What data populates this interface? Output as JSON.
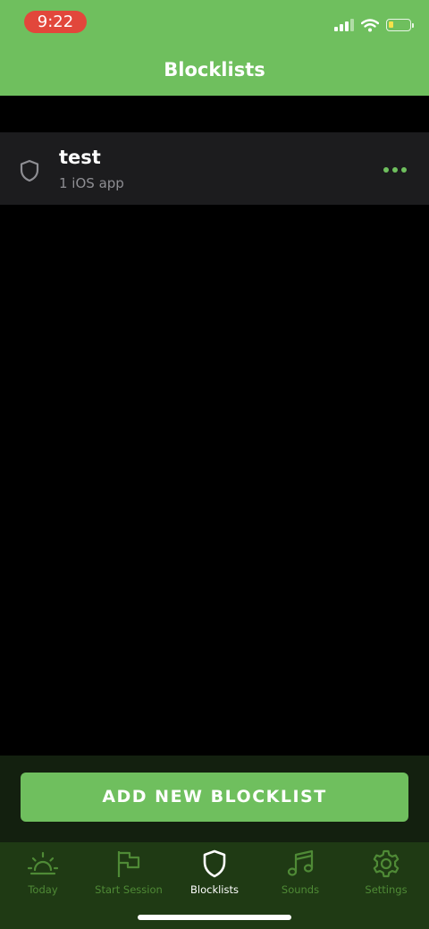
{
  "status_bar": {
    "time": "9:22",
    "icons": [
      "cellular-signal-icon",
      "wifi-icon",
      "battery-icon"
    ],
    "battery_level": 0.25
  },
  "header": {
    "title": "Blocklists"
  },
  "blocklists": [
    {
      "name": "test",
      "detail": "1 iOS app",
      "icon": "shield-icon",
      "menu_icon": "more-options-icon"
    }
  ],
  "actions": {
    "add_label": "ADD NEW BLOCKLIST"
  },
  "tabs": [
    {
      "label": "Today",
      "icon": "sunrise-icon",
      "active": false
    },
    {
      "label": "Start Session",
      "icon": "flag-icon",
      "active": false
    },
    {
      "label": "Blocklists",
      "icon": "shield-icon",
      "active": true
    },
    {
      "label": "Sounds",
      "icon": "music-note-icon",
      "active": false
    },
    {
      "label": "Settings",
      "icon": "gear-icon",
      "active": false
    }
  ],
  "colors": {
    "accent": "#6fbf5e",
    "time_pill": "#e2473b",
    "tab_inactive": "#4f8a36",
    "tab_bar": "#1f3a14",
    "list_row": "#1c1c1e"
  }
}
